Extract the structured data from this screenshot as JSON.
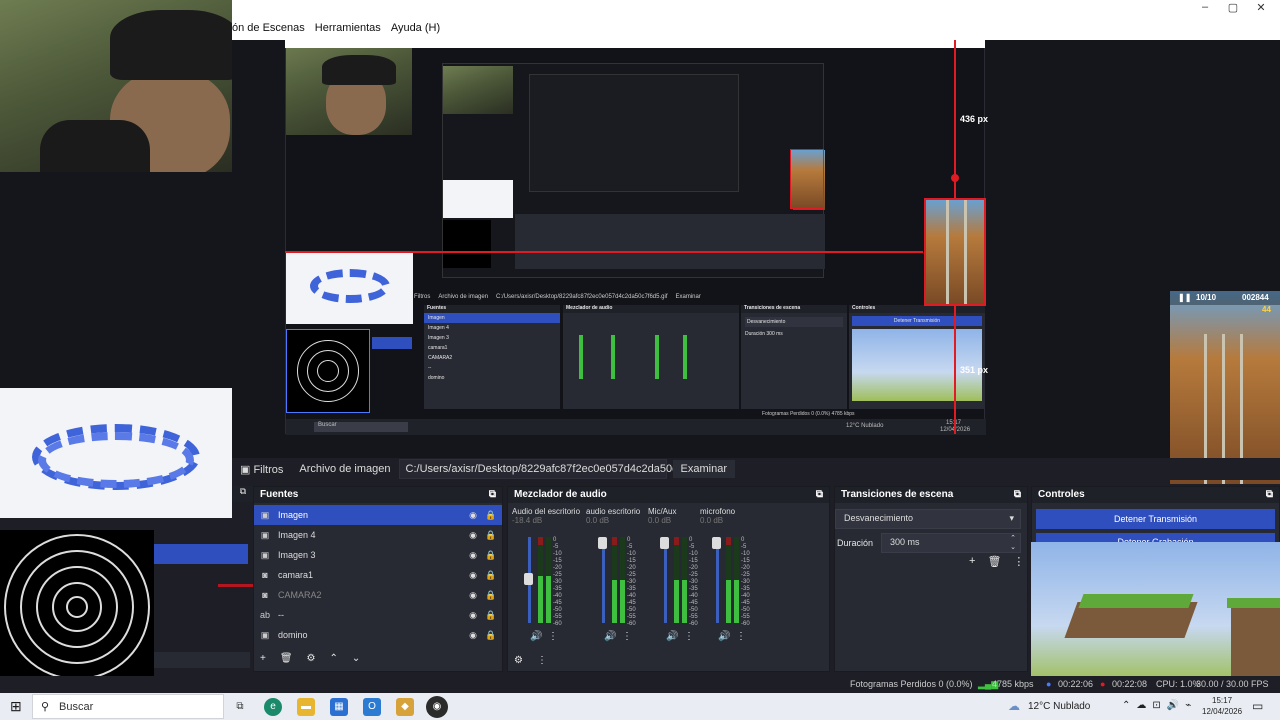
{
  "window": {
    "menu_fragment": "ón de Escenas",
    "menu_tools": "Herramientas",
    "menu_help": "Ayuda (H)",
    "btn_min": "–",
    "btn_max": "▢",
    "btn_close": "✕"
  },
  "preview": {
    "label_436": "436 px",
    "label_1756": "1756 px",
    "label_351": "351 px",
    "game_score_left": "10/10",
    "game_score_right": "002844",
    "game_coins": "44"
  },
  "nested": {
    "filters_btn": "Filtros",
    "image_file_label": "Archivo de imagen",
    "path": "C:/Users/axisr/Desktop/8229afc87f2ec0e057d4c2da50c7f6d5.gif",
    "browse_btn": "Examinar",
    "sources_title": "Fuentes",
    "mixer_title": "Mezclador de audio",
    "transitions_title": "Transiciones de escena",
    "controls_title": "Controles",
    "stop_stream": "Detener Transmisión",
    "transition_value": "Desvanecimiento",
    "duration_label": "Duración",
    "duration_value": "300 ms",
    "search": "Buscar",
    "weather": "12°C Nublado",
    "status": "Fotogramas Perdidos 0 (0.0%)  4785 kbps",
    "src1": "Imagen",
    "src2": "Imagen 4",
    "src3": "Imagen 3",
    "src4": "camara1",
    "src5": "CAMARA2",
    "src6": "--",
    "src7": "domino",
    "time": "15:17",
    "date": "12/04/2026"
  },
  "properties": {
    "filters_btn": "Filtros",
    "image_file_label": "Archivo de imagen",
    "path": "C:/Users/axisr/Desktop/8229afc87f2ec0e057d4c2da50c7f6d5.gif",
    "browse_btn": "Examinar"
  },
  "sources": {
    "title": "Fuentes",
    "items": [
      {
        "name": "Imagen",
        "icon": "▣"
      },
      {
        "name": "Imagen 4",
        "icon": "▣"
      },
      {
        "name": "Imagen 3",
        "icon": "▣"
      },
      {
        "name": "camara1",
        "icon": "◙"
      },
      {
        "name": "CAMARA2",
        "icon": "◙"
      },
      {
        "name": "--",
        "icon": "ab"
      },
      {
        "name": "domino",
        "icon": "▣"
      }
    ],
    "btn_add": "+",
    "btn_remove": "🗑",
    "btn_settings": "⚙",
    "btn_up": "⌃",
    "btn_down": "⌄"
  },
  "mixer": {
    "title": "Mezclador de audio",
    "channels": [
      {
        "name": "Audio del escritorio",
        "db": "-18.4 dB",
        "level": 0.55
      },
      {
        "name": "audio escritorio",
        "db": "0.0 dB",
        "level": 0.5
      },
      {
        "name": "Mic/Aux",
        "db": "0.0 dB",
        "level": 0.5
      },
      {
        "name": "microfono",
        "db": "0.0 dB",
        "level": 0.5
      }
    ],
    "scale": [
      "0",
      "-5",
      "-10",
      "-15",
      "-20",
      "-25",
      "-30",
      "-35",
      "-40",
      "-45",
      "-50",
      "-55",
      "-60"
    ]
  },
  "transitions": {
    "title": "Transiciones de escena",
    "selected": "Desvanecimiento",
    "duration_label": "Duración",
    "duration_value": "300 ms"
  },
  "controls": {
    "title": "Controles",
    "stop_stream": "Detener Transmisión",
    "stop_recording": "Detener Grabación"
  },
  "status": {
    "dropped": "Fotogramas Perdidos 0 (0.0%)",
    "bitrate": "4785 kbps",
    "stream_time": "00:22:06",
    "rec_time": "00:22:08",
    "cpu": "CPU: 1.0%",
    "fps": "30.00 / 30.00 FPS"
  },
  "taskbar": {
    "search_placeholder": "Buscar",
    "weather": "12°C  Nublado",
    "time": "15:17",
    "date": "12/04/2026"
  },
  "colors": {
    "accent": "#2f4fbf",
    "red_guide": "#e01b24",
    "meter_green": "#3fbf3f"
  }
}
